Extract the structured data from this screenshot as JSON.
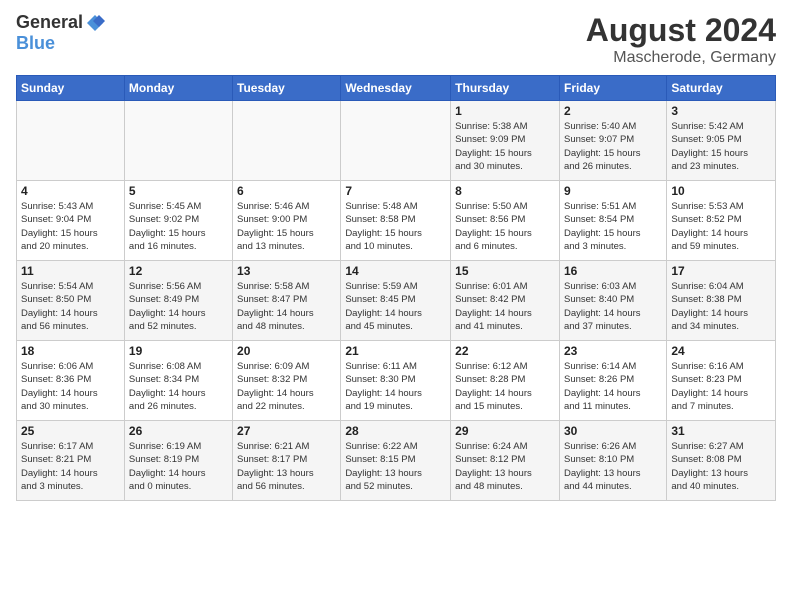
{
  "header": {
    "logo_general": "General",
    "logo_blue": "Blue",
    "title": "August 2024",
    "location": "Mascherode, Germany"
  },
  "weekdays": [
    "Sunday",
    "Monday",
    "Tuesday",
    "Wednesday",
    "Thursday",
    "Friday",
    "Saturday"
  ],
  "weeks": [
    [
      {
        "day": "",
        "info": ""
      },
      {
        "day": "",
        "info": ""
      },
      {
        "day": "",
        "info": ""
      },
      {
        "day": "",
        "info": ""
      },
      {
        "day": "1",
        "info": "Sunrise: 5:38 AM\nSunset: 9:09 PM\nDaylight: 15 hours\nand 30 minutes."
      },
      {
        "day": "2",
        "info": "Sunrise: 5:40 AM\nSunset: 9:07 PM\nDaylight: 15 hours\nand 26 minutes."
      },
      {
        "day": "3",
        "info": "Sunrise: 5:42 AM\nSunset: 9:05 PM\nDaylight: 15 hours\nand 23 minutes."
      }
    ],
    [
      {
        "day": "4",
        "info": "Sunrise: 5:43 AM\nSunset: 9:04 PM\nDaylight: 15 hours\nand 20 minutes."
      },
      {
        "day": "5",
        "info": "Sunrise: 5:45 AM\nSunset: 9:02 PM\nDaylight: 15 hours\nand 16 minutes."
      },
      {
        "day": "6",
        "info": "Sunrise: 5:46 AM\nSunset: 9:00 PM\nDaylight: 15 hours\nand 13 minutes."
      },
      {
        "day": "7",
        "info": "Sunrise: 5:48 AM\nSunset: 8:58 PM\nDaylight: 15 hours\nand 10 minutes."
      },
      {
        "day": "8",
        "info": "Sunrise: 5:50 AM\nSunset: 8:56 PM\nDaylight: 15 hours\nand 6 minutes."
      },
      {
        "day": "9",
        "info": "Sunrise: 5:51 AM\nSunset: 8:54 PM\nDaylight: 15 hours\nand 3 minutes."
      },
      {
        "day": "10",
        "info": "Sunrise: 5:53 AM\nSunset: 8:52 PM\nDaylight: 14 hours\nand 59 minutes."
      }
    ],
    [
      {
        "day": "11",
        "info": "Sunrise: 5:54 AM\nSunset: 8:50 PM\nDaylight: 14 hours\nand 56 minutes."
      },
      {
        "day": "12",
        "info": "Sunrise: 5:56 AM\nSunset: 8:49 PM\nDaylight: 14 hours\nand 52 minutes."
      },
      {
        "day": "13",
        "info": "Sunrise: 5:58 AM\nSunset: 8:47 PM\nDaylight: 14 hours\nand 48 minutes."
      },
      {
        "day": "14",
        "info": "Sunrise: 5:59 AM\nSunset: 8:45 PM\nDaylight: 14 hours\nand 45 minutes."
      },
      {
        "day": "15",
        "info": "Sunrise: 6:01 AM\nSunset: 8:42 PM\nDaylight: 14 hours\nand 41 minutes."
      },
      {
        "day": "16",
        "info": "Sunrise: 6:03 AM\nSunset: 8:40 PM\nDaylight: 14 hours\nand 37 minutes."
      },
      {
        "day": "17",
        "info": "Sunrise: 6:04 AM\nSunset: 8:38 PM\nDaylight: 14 hours\nand 34 minutes."
      }
    ],
    [
      {
        "day": "18",
        "info": "Sunrise: 6:06 AM\nSunset: 8:36 PM\nDaylight: 14 hours\nand 30 minutes."
      },
      {
        "day": "19",
        "info": "Sunrise: 6:08 AM\nSunset: 8:34 PM\nDaylight: 14 hours\nand 26 minutes."
      },
      {
        "day": "20",
        "info": "Sunrise: 6:09 AM\nSunset: 8:32 PM\nDaylight: 14 hours\nand 22 minutes."
      },
      {
        "day": "21",
        "info": "Sunrise: 6:11 AM\nSunset: 8:30 PM\nDaylight: 14 hours\nand 19 minutes."
      },
      {
        "day": "22",
        "info": "Sunrise: 6:12 AM\nSunset: 8:28 PM\nDaylight: 14 hours\nand 15 minutes."
      },
      {
        "day": "23",
        "info": "Sunrise: 6:14 AM\nSunset: 8:26 PM\nDaylight: 14 hours\nand 11 minutes."
      },
      {
        "day": "24",
        "info": "Sunrise: 6:16 AM\nSunset: 8:23 PM\nDaylight: 14 hours\nand 7 minutes."
      }
    ],
    [
      {
        "day": "25",
        "info": "Sunrise: 6:17 AM\nSunset: 8:21 PM\nDaylight: 14 hours\nand 3 minutes."
      },
      {
        "day": "26",
        "info": "Sunrise: 6:19 AM\nSunset: 8:19 PM\nDaylight: 14 hours\nand 0 minutes."
      },
      {
        "day": "27",
        "info": "Sunrise: 6:21 AM\nSunset: 8:17 PM\nDaylight: 13 hours\nand 56 minutes."
      },
      {
        "day": "28",
        "info": "Sunrise: 6:22 AM\nSunset: 8:15 PM\nDaylight: 13 hours\nand 52 minutes."
      },
      {
        "day": "29",
        "info": "Sunrise: 6:24 AM\nSunset: 8:12 PM\nDaylight: 13 hours\nand 48 minutes."
      },
      {
        "day": "30",
        "info": "Sunrise: 6:26 AM\nSunset: 8:10 PM\nDaylight: 13 hours\nand 44 minutes."
      },
      {
        "day": "31",
        "info": "Sunrise: 6:27 AM\nSunset: 8:08 PM\nDaylight: 13 hours\nand 40 minutes."
      }
    ]
  ]
}
